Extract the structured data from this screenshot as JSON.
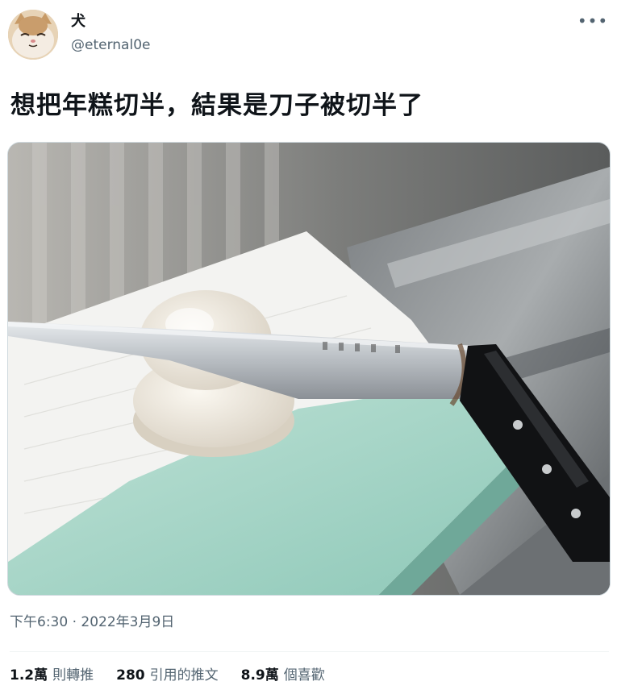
{
  "author": {
    "display_name": "犬",
    "handle": "@eternal0e",
    "avatar_icon": "cat-avatar-icon"
  },
  "more_icon_glyph": "•••",
  "tweet": {
    "text": "想把年糕切半，結果是刀子被切半了",
    "media_description": "photo-knife-mochi"
  },
  "meta": {
    "timestamp": "下午6:30 · 2022年3月9日"
  },
  "stats": [
    {
      "count": "1.2萬",
      "label": "則轉推"
    },
    {
      "count": "280",
      "label": "引用的推文"
    },
    {
      "count": "8.9萬",
      "label": "個喜歡"
    }
  ],
  "colors": {
    "text_primary": "#0f1419",
    "text_secondary": "#536471",
    "divider": "#eff3f4"
  }
}
